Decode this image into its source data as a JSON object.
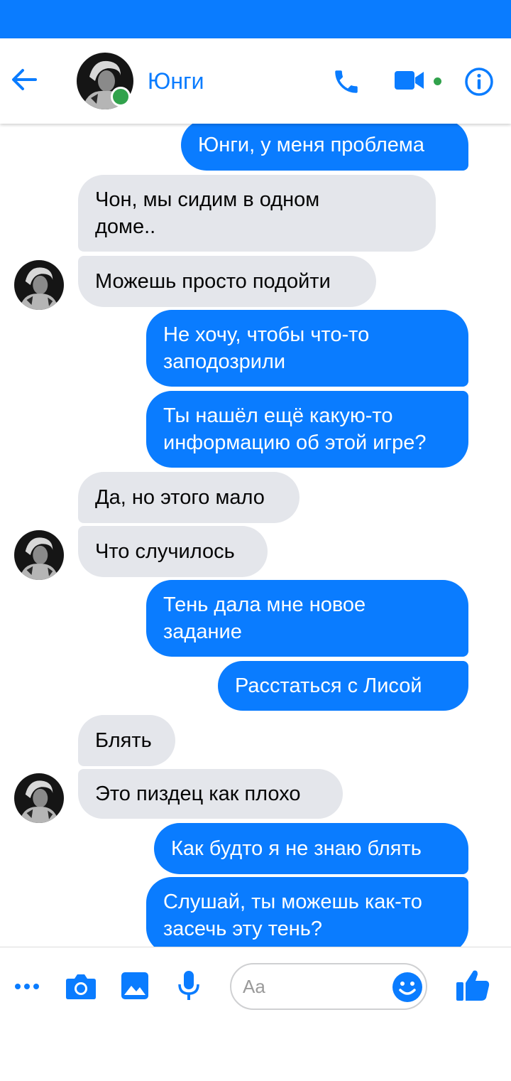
{
  "colors": {
    "accent": "#0a7cff",
    "incoming_bubble": "#e4e6eb",
    "online": "#31a24c"
  },
  "header": {
    "contact_name": "Юнги",
    "icons": [
      "back-arrow-icon",
      "phone-icon",
      "video-camera-icon",
      "info-icon"
    ]
  },
  "messages": [
    {
      "direction": "outgoing",
      "text": "Юнги, у меня проблема"
    },
    {
      "direction": "incoming",
      "text": "Чон, мы сидим в одном\nдоме.."
    },
    {
      "direction": "incoming",
      "text": "Можешь просто подойти"
    },
    {
      "direction": "outgoing",
      "text": "Не хочу, чтобы что-то\nзаподозрили"
    },
    {
      "direction": "outgoing",
      "text": "Ты нашёл ещё какую-то\nинформацию об этой игре?"
    },
    {
      "direction": "incoming",
      "text": "Да, но этого мало"
    },
    {
      "direction": "incoming",
      "text": "Что случилось"
    },
    {
      "direction": "outgoing",
      "text": "Тень дала мне новое\nзадание"
    },
    {
      "direction": "outgoing",
      "text": "Расстаться с Лисой"
    },
    {
      "direction": "incoming",
      "text": "Блять"
    },
    {
      "direction": "incoming",
      "text": "Это пиздец как плохо"
    },
    {
      "direction": "outgoing",
      "text": "Как будто я не знаю блять"
    },
    {
      "direction": "outgoing",
      "text": "Слушай, ты можешь как-то\nзасечь эту тень?"
    }
  ],
  "composer": {
    "placeholder": "Aa",
    "icons": [
      "more-icon",
      "camera-icon",
      "image-icon",
      "microphone-icon",
      "emoji-icon",
      "thumbs-up-icon"
    ]
  }
}
